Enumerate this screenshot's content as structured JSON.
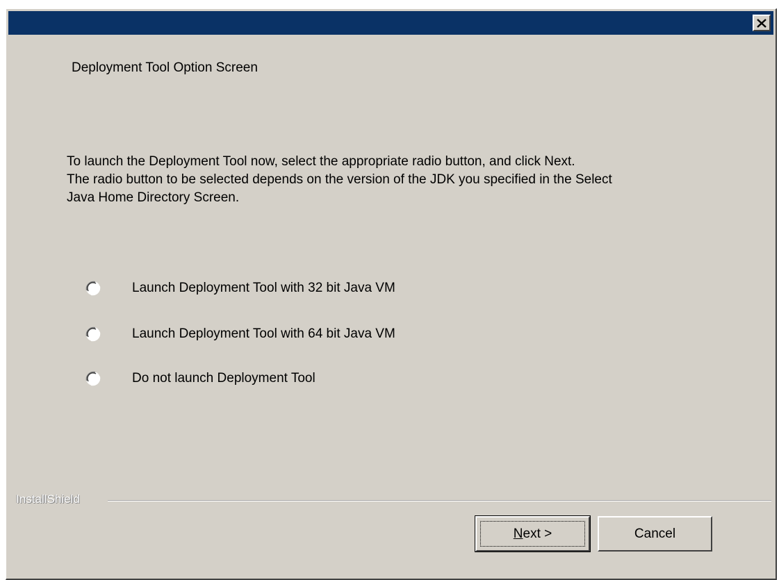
{
  "window": {
    "close_glyph": "×"
  },
  "heading": "Deployment Tool Option Screen",
  "description": {
    "lines": [
      "To launch the Deployment Tool now, select the appropriate radio button, and click Next.",
      "The radio button to be selected depends on the version of the JDK you specified in the Select",
      "Java Home Directory Screen."
    ]
  },
  "options": [
    {
      "label": "Launch Deployment Tool with 32 bit Java VM",
      "selected": false
    },
    {
      "label": "Launch Deployment Tool with 64 bit Java VM",
      "selected": false
    },
    {
      "label": "Do not launch Deployment Tool",
      "selected": false
    }
  ],
  "brand": "InstallShield",
  "buttons": {
    "next_accel": "N",
    "next_rest": "ext >",
    "cancel": "Cancel"
  },
  "colors": {
    "titlebar": "#0a3266",
    "dialog_bg": "#d4d0c8"
  }
}
